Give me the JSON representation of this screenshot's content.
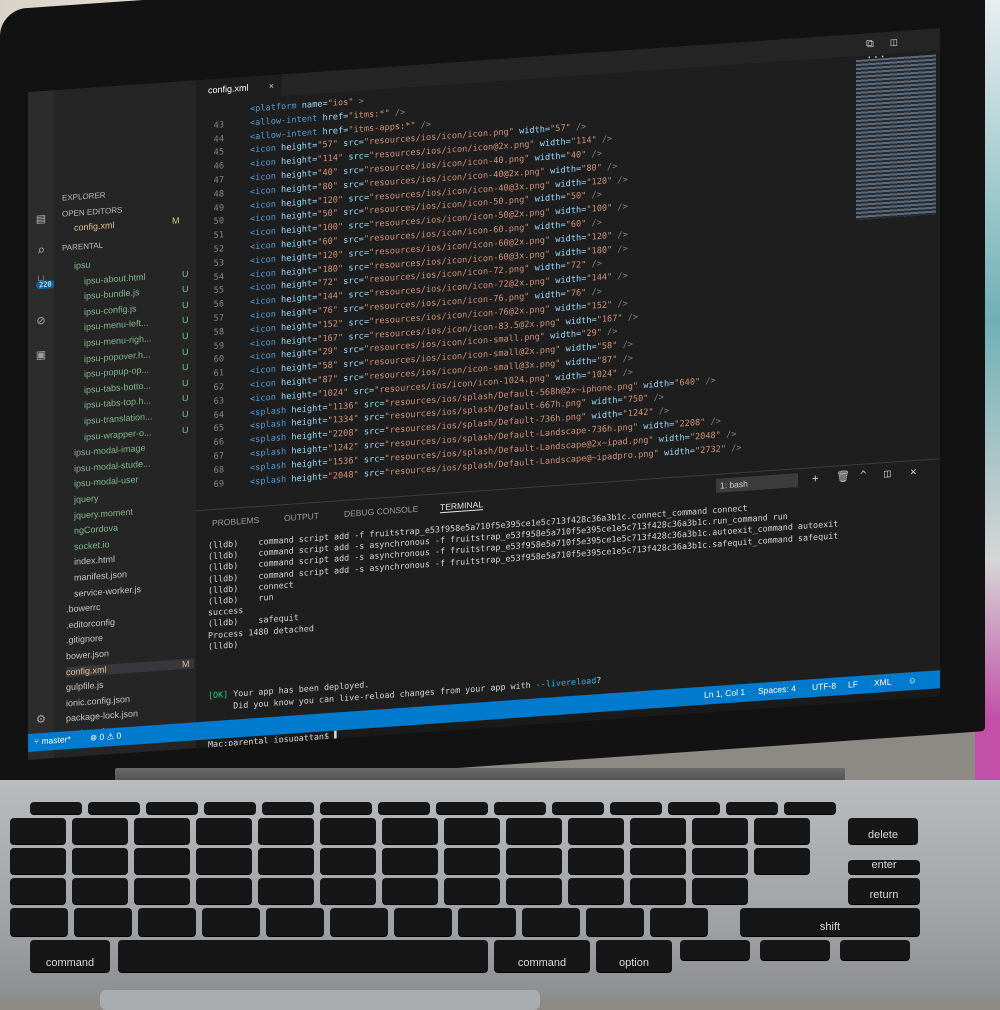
{
  "window": {
    "tab_title": "config.xml",
    "tab_close": "×",
    "top_icons": [
      "⧉",
      "◫",
      "···"
    ]
  },
  "activity_bar": {
    "badge": "220",
    "icons": [
      "files-icon",
      "search-icon",
      "source-control-icon",
      "debug-icon",
      "extensions-icon",
      "gear-icon"
    ]
  },
  "sidebar": {
    "explorer_title": "EXPLORER",
    "open_editors_title": "OPEN EDITORS",
    "open_editor_item": {
      "name": "config.xml",
      "status": "M"
    },
    "project_title": "PARENTAL",
    "items": [
      {
        "name": "ipsu",
        "status": "",
        "cls": "green",
        "indent": 10
      },
      {
        "name": "ipsu-about.html",
        "status": "U",
        "cls": "green",
        "indent": 20
      },
      {
        "name": "ipsu-bundle.js",
        "status": "U",
        "cls": "green",
        "indent": 20
      },
      {
        "name": "ipsu-config.js",
        "status": "U",
        "cls": "green",
        "indent": 20
      },
      {
        "name": "ipsu-menu-left...",
        "status": "U",
        "cls": "green",
        "indent": 20
      },
      {
        "name": "ipsu-menu-righ...",
        "status": "U",
        "cls": "green",
        "indent": 20
      },
      {
        "name": "ipsu-popover.h...",
        "status": "U",
        "cls": "green",
        "indent": 20
      },
      {
        "name": "ipsu-popup-op...",
        "status": "U",
        "cls": "green",
        "indent": 20
      },
      {
        "name": "ipsu-tabs-botto...",
        "status": "U",
        "cls": "green",
        "indent": 20
      },
      {
        "name": "ipsu-tabs-top.h...",
        "status": "U",
        "cls": "green",
        "indent": 20
      },
      {
        "name": "ipsu-translation...",
        "status": "U",
        "cls": "green",
        "indent": 20
      },
      {
        "name": "ipsu-wrapper-o...",
        "status": "U",
        "cls": "green",
        "indent": 20
      },
      {
        "name": "ipsu-modal-image",
        "status": "",
        "cls": "green",
        "indent": 10
      },
      {
        "name": "ipsu-modal-stude...",
        "status": "",
        "cls": "green",
        "indent": 10
      },
      {
        "name": "ipsu-modal-user",
        "status": "",
        "cls": "green",
        "indent": 10
      },
      {
        "name": "jquery",
        "status": "",
        "cls": "green",
        "indent": 10
      },
      {
        "name": "jquery.moment",
        "status": "",
        "cls": "green",
        "indent": 10
      },
      {
        "name": "ngCordova",
        "status": "",
        "cls": "green",
        "indent": 10
      },
      {
        "name": "socket.io",
        "status": "",
        "cls": "green",
        "indent": 10
      },
      {
        "name": "index.html",
        "status": "",
        "cls": "",
        "indent": 10
      },
      {
        "name": "manifest.json",
        "status": "",
        "cls": "",
        "indent": 10
      },
      {
        "name": "service-worker.js",
        "status": "",
        "cls": "",
        "indent": 10
      },
      {
        "name": ".bowerrc",
        "status": "",
        "cls": "",
        "indent": 2
      },
      {
        "name": ".editorconfig",
        "status": "",
        "cls": "",
        "indent": 2
      },
      {
        "name": ".gitignore",
        "status": "",
        "cls": "",
        "indent": 2
      },
      {
        "name": "bower.json",
        "status": "",
        "cls": "",
        "indent": 2
      },
      {
        "name": "config.xml",
        "status": "M",
        "cls": "yellow active",
        "indent": 2
      },
      {
        "name": "gulpfile.js",
        "status": "",
        "cls": "",
        "indent": 2
      },
      {
        "name": "ionic.config.json",
        "status": "",
        "cls": "",
        "indent": 2
      },
      {
        "name": "package-lock.json",
        "status": "",
        "cls": "",
        "indent": 2
      },
      {
        "name": "package.json",
        "status": "",
        "cls": "",
        "indent": 2
      }
    ]
  },
  "editor": {
    "lines": [
      {
        "n": "",
        "tag": "<platform",
        "attrs": [
          [
            "name",
            "ios"
          ]
        ],
        "end": ">"
      },
      {
        "n": "43",
        "tag": "<allow-intent",
        "attrs": [
          [
            "href",
            "itms:*"
          ]
        ],
        "end": "/>"
      },
      {
        "n": "44",
        "tag": "<allow-intent",
        "attrs": [
          [
            "href",
            "itms-apps:*"
          ]
        ],
        "end": "/>"
      },
      {
        "n": "45",
        "tag": "<icon",
        "attrs": [
          [
            "height",
            "57"
          ],
          [
            "src",
            "resources/ios/icon/icon.png"
          ],
          [
            "width",
            "57"
          ]
        ],
        "end": "/>"
      },
      {
        "n": "46",
        "tag": "<icon",
        "attrs": [
          [
            "height",
            "114"
          ],
          [
            "src",
            "resources/ios/icon/icon@2x.png"
          ],
          [
            "width",
            "114"
          ]
        ],
        "end": "/>"
      },
      {
        "n": "47",
        "tag": "<icon",
        "attrs": [
          [
            "height",
            "40"
          ],
          [
            "src",
            "resources/ios/icon/icon-40.png"
          ],
          [
            "width",
            "40"
          ]
        ],
        "end": "/>"
      },
      {
        "n": "48",
        "tag": "<icon",
        "attrs": [
          [
            "height",
            "80"
          ],
          [
            "src",
            "resources/ios/icon/icon-40@2x.png"
          ],
          [
            "width",
            "80"
          ]
        ],
        "end": "/>"
      },
      {
        "n": "49",
        "tag": "<icon",
        "attrs": [
          [
            "height",
            "120"
          ],
          [
            "src",
            "resources/ios/icon/icon-40@3x.png"
          ],
          [
            "width",
            "120"
          ]
        ],
        "end": "/>"
      },
      {
        "n": "50",
        "tag": "<icon",
        "attrs": [
          [
            "height",
            "50"
          ],
          [
            "src",
            "resources/ios/icon/icon-50.png"
          ],
          [
            "width",
            "50"
          ]
        ],
        "end": "/>"
      },
      {
        "n": "51",
        "tag": "<icon",
        "attrs": [
          [
            "height",
            "100"
          ],
          [
            "src",
            "resources/ios/icon/icon-50@2x.png"
          ],
          [
            "width",
            "100"
          ]
        ],
        "end": "/>"
      },
      {
        "n": "52",
        "tag": "<icon",
        "attrs": [
          [
            "height",
            "60"
          ],
          [
            "src",
            "resources/ios/icon/icon-60.png"
          ],
          [
            "width",
            "60"
          ]
        ],
        "end": "/>"
      },
      {
        "n": "53",
        "tag": "<icon",
        "attrs": [
          [
            "height",
            "120"
          ],
          [
            "src",
            "resources/ios/icon/icon-60@2x.png"
          ],
          [
            "width",
            "120"
          ]
        ],
        "end": "/>"
      },
      {
        "n": "54",
        "tag": "<icon",
        "attrs": [
          [
            "height",
            "180"
          ],
          [
            "src",
            "resources/ios/icon/icon-60@3x.png"
          ],
          [
            "width",
            "180"
          ]
        ],
        "end": "/>"
      },
      {
        "n": "55",
        "tag": "<icon",
        "attrs": [
          [
            "height",
            "72"
          ],
          [
            "src",
            "resources/ios/icon/icon-72.png"
          ],
          [
            "width",
            "72"
          ]
        ],
        "end": "/>"
      },
      {
        "n": "56",
        "tag": "<icon",
        "attrs": [
          [
            "height",
            "144"
          ],
          [
            "src",
            "resources/ios/icon/icon-72@2x.png"
          ],
          [
            "width",
            "144"
          ]
        ],
        "end": "/>"
      },
      {
        "n": "57",
        "tag": "<icon",
        "attrs": [
          [
            "height",
            "76"
          ],
          [
            "src",
            "resources/ios/icon/icon-76.png"
          ],
          [
            "width",
            "76"
          ]
        ],
        "end": "/>"
      },
      {
        "n": "58",
        "tag": "<icon",
        "attrs": [
          [
            "height",
            "152"
          ],
          [
            "src",
            "resources/ios/icon/icon-76@2x.png"
          ],
          [
            "width",
            "152"
          ]
        ],
        "end": "/>"
      },
      {
        "n": "59",
        "tag": "<icon",
        "attrs": [
          [
            "height",
            "167"
          ],
          [
            "src",
            "resources/ios/icon/icon-83.5@2x.png"
          ],
          [
            "width",
            "167"
          ]
        ],
        "end": "/>"
      },
      {
        "n": "60",
        "tag": "<icon",
        "attrs": [
          [
            "height",
            "29"
          ],
          [
            "src",
            "resources/ios/icon/icon-small.png"
          ],
          [
            "width",
            "29"
          ]
        ],
        "end": "/>"
      },
      {
        "n": "61",
        "tag": "<icon",
        "attrs": [
          [
            "height",
            "58"
          ],
          [
            "src",
            "resources/ios/icon/icon-small@2x.png"
          ],
          [
            "width",
            "58"
          ]
        ],
        "end": "/>"
      },
      {
        "n": "62",
        "tag": "<icon",
        "attrs": [
          [
            "height",
            "87"
          ],
          [
            "src",
            "resources/ios/icon/icon-small@3x.png"
          ],
          [
            "width",
            "87"
          ]
        ],
        "end": "/>"
      },
      {
        "n": "63",
        "tag": "<icon",
        "attrs": [
          [
            "height",
            "1024"
          ],
          [
            "src",
            "resources/ios/icon/icon-1024.png"
          ],
          [
            "width",
            "1024"
          ]
        ],
        "end": "/>"
      },
      {
        "n": "64",
        "tag": "<splash",
        "attrs": [
          [
            "height",
            "1136"
          ],
          [
            "src",
            "resources/ios/splash/Default-568h@2x~iphone.png"
          ],
          [
            "width",
            "640"
          ]
        ],
        "end": "/>"
      },
      {
        "n": "65",
        "tag": "<splash",
        "attrs": [
          [
            "height",
            "1334"
          ],
          [
            "src",
            "resources/ios/splash/Default-667h.png"
          ],
          [
            "width",
            "750"
          ]
        ],
        "end": "/>"
      },
      {
        "n": "66",
        "tag": "<splash",
        "attrs": [
          [
            "height",
            "2208"
          ],
          [
            "src",
            "resources/ios/splash/Default-736h.png"
          ],
          [
            "width",
            "1242"
          ]
        ],
        "end": "/>"
      },
      {
        "n": "67",
        "tag": "<splash",
        "attrs": [
          [
            "height",
            "1242"
          ],
          [
            "src",
            "resources/ios/splash/Default-Landscape-736h.png"
          ],
          [
            "width",
            "2208"
          ]
        ],
        "end": "/>"
      },
      {
        "n": "68",
        "tag": "<splash",
        "attrs": [
          [
            "height",
            "1536"
          ],
          [
            "src",
            "resources/ios/splash/Default-Landscape@2x~ipad.png"
          ],
          [
            "width",
            "2048"
          ]
        ],
        "end": "/>"
      },
      {
        "n": "69",
        "tag": "<splash",
        "attrs": [
          [
            "height",
            "2048"
          ],
          [
            "src",
            "resources/ios/splash/Default-Landscape@~ipadpro.png"
          ],
          [
            "width",
            "2732"
          ]
        ],
        "end": "/>"
      }
    ]
  },
  "panel": {
    "tabs": [
      "PROBLEMS",
      "OUTPUT",
      "DEBUG CONSOLE",
      "TERMINAL"
    ],
    "active_tab": "TERMINAL",
    "terminal_select": "1: bash",
    "icons": [
      "+",
      "🗑",
      "^",
      "◫",
      "×"
    ],
    "terminal_lines": [
      "(lldb)    command script add -f fruitstrap_e53f958e5a710f5e395ce1e5c713f428c36a3b1c.connect_command connect",
      "(lldb)    command script add -s asynchronous -f fruitstrap_e53f958e5a710f5e395ce1e5c713f428c36a3b1c.run_command run",
      "(lldb)    command script add -s asynchronous -f fruitstrap_e53f958e5a710f5e395ce1e5c713f428c36a3b1c.autoexit_command autoexit",
      "(lldb)    command script add -s asynchronous -f fruitstrap_e53f958e5a710f5e395ce1e5c713f428c36a3b1c.safequit_command safequit",
      "(lldb)    connect",
      "(lldb)    run",
      "success",
      "(lldb)    safequit",
      "Process 1480 detached",
      "(lldb)"
    ],
    "ok_tag": "[OK]",
    "ok_message": " Your app has been deployed.",
    "livereload_prefix": "     Did you know you can live-reload changes from your app with ",
    "livereload_flag": "--livereload",
    "livereload_suffix": "?",
    "prompt": "Mac:parental ipsupattan$ "
  },
  "statusbar": {
    "branch": "⑂ master*",
    "problems": "⊗ 0 ⚠ 0",
    "position": "Ln 1, Col 1",
    "spaces": "Spaces: 4",
    "encoding": "UTF-8",
    "eol": "LF",
    "language": "XML",
    "feedback": "☺"
  },
  "keyboard": {
    "labels": [
      "delete",
      "return",
      "enter",
      "shift",
      "command",
      "⌘",
      "option",
      "alt",
      "command",
      "⌘"
    ]
  }
}
